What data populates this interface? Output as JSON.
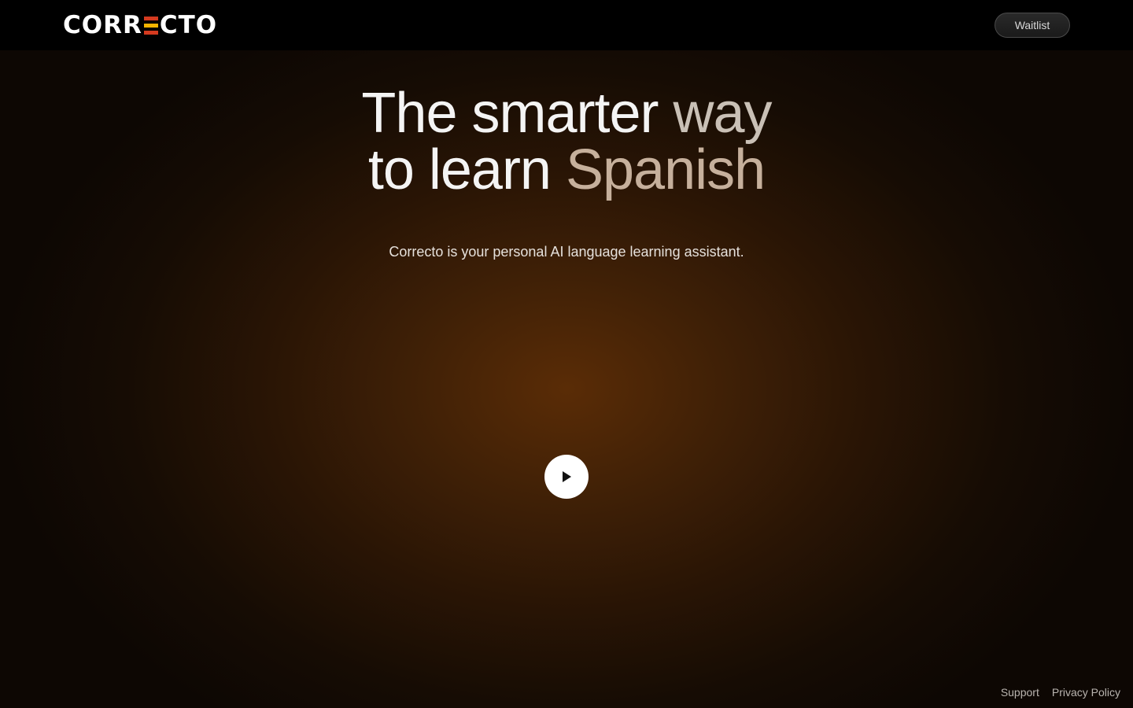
{
  "brand": {
    "logo_parts": [
      "CORR",
      "CTO"
    ],
    "logo_text": "CORRECTO",
    "logo_e_colors": [
      "#d43a1f",
      "#f5b400",
      "#d43a1f"
    ]
  },
  "nav": {
    "waitlist_label": "Waitlist"
  },
  "hero": {
    "title_line1_a": "The smarter ",
    "title_line1_b": "way",
    "title_line2_a": "to learn ",
    "title_line2_b": "Spanish",
    "subtitle": "Correcto is your personal AI language learning assistant."
  },
  "video": {
    "play_icon": "play-icon"
  },
  "footer": {
    "links": [
      "Support",
      "Privacy Policy"
    ]
  },
  "colors": {
    "accent_glow": "#5a2c06",
    "background": "#0c0703",
    "nav_background": "#000000"
  }
}
